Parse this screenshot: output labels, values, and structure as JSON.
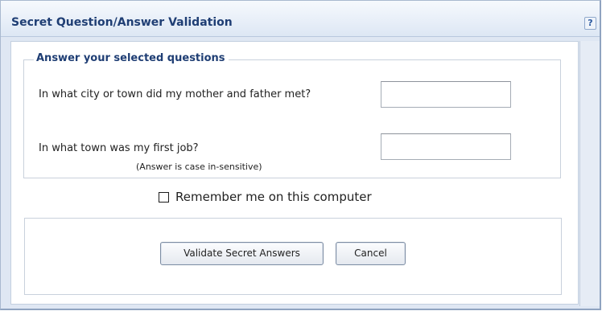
{
  "dialog": {
    "title": "Secret Question/Answer Validation",
    "help_label": "?"
  },
  "qa": {
    "legend": "Answer your selected questions",
    "questions": [
      {
        "text": "In what city or town did my mother and father met?",
        "answer_value": ""
      },
      {
        "text": "In what town was my first job?",
        "answer_value": ""
      }
    ],
    "note": "(Answer is case in-sensitive)"
  },
  "remember": {
    "label": "Remember me on this computer",
    "checked": false
  },
  "buttons": {
    "validate_label": "Validate Secret Answers",
    "cancel_label": "Cancel"
  },
  "colors": {
    "title_text": "#1f3e74",
    "frame_background": "#dfe7f3",
    "border": "#a9b9cf"
  }
}
